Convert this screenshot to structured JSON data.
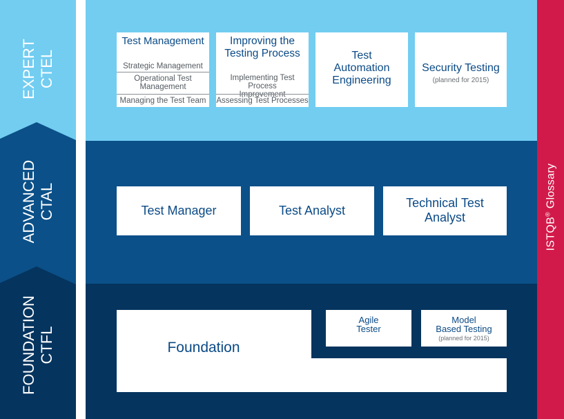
{
  "colors": {
    "expert_band": "#72cdf1",
    "advanced_band": "#0b5088",
    "foundation_band": "#05345e",
    "glossary_bar": "#d21a4a",
    "box_text": "#0b4a86",
    "sub_text": "#555b61"
  },
  "levels": {
    "expert": {
      "name": "EXPERT",
      "code": "CTEL"
    },
    "advanced": {
      "name": "ADVANCED",
      "code": "CTAL"
    },
    "foundation": {
      "name": "FOUNDATION",
      "code": "CTFL"
    }
  },
  "glossary": {
    "label": "ISTQB",
    "mark": "®",
    "suffix": " Glossary"
  },
  "expert_modules": {
    "test_management": {
      "title": "Test Management",
      "parts": [
        "Strategic Management",
        "Operational Test Management",
        "Managing the Test Team"
      ]
    },
    "improving": {
      "title_line1": "Improving the",
      "title_line2": "Testing Process",
      "parts": [
        "Implementing Test Process Improvement",
        "Assessing Test Processes"
      ]
    },
    "automation": {
      "line1": "Test",
      "line2": "Automation",
      "line3": "Engineering"
    },
    "security": {
      "title": "Security Testing",
      "note": "(planned for 2015)"
    }
  },
  "advanced_modules": {
    "test_manager": "Test Manager",
    "test_analyst": "Test Analyst",
    "technical_line1": "Technical Test",
    "technical_line2": "Analyst"
  },
  "foundation_modules": {
    "foundation": "Foundation",
    "agile_line1": "Agile",
    "agile_line2": "Tester",
    "mbt_line1": "Model",
    "mbt_line2": "Based Testing",
    "mbt_note": "(planned for 2015)"
  }
}
